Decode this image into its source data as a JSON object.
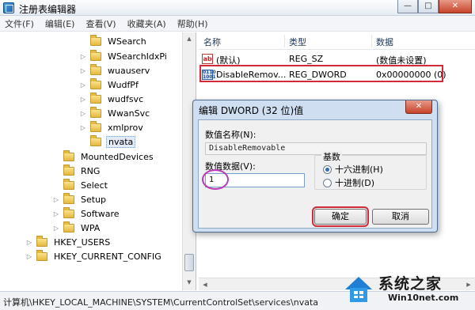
{
  "window": {
    "title": "注册表编辑器",
    "minimize": "—",
    "maximize": "□",
    "close": "✕"
  },
  "menu": [
    "文件(F)",
    "编辑(E)",
    "查看(V)",
    "收藏夹(A)",
    "帮助(H)"
  ],
  "tree": {
    "items": [
      {
        "label": "WSearch",
        "expandable": false
      },
      {
        "label": "WSearchIdxPi",
        "expandable": true
      },
      {
        "label": "wuauserv",
        "expandable": true
      },
      {
        "label": "WudfPf",
        "expandable": true
      },
      {
        "label": "wudfsvc",
        "expandable": true
      },
      {
        "label": "WwanSvc",
        "expandable": true
      },
      {
        "label": "xmlprov",
        "expandable": true
      },
      {
        "label": "nvata",
        "expandable": false,
        "selected": true
      },
      {
        "label": "MountedDevices",
        "expandable": false
      },
      {
        "label": "RNG",
        "expandable": false
      },
      {
        "label": "Select",
        "expandable": false
      },
      {
        "label": "Setup",
        "expandable": true
      },
      {
        "label": "Software",
        "expandable": true
      },
      {
        "label": "WPA",
        "expandable": true
      },
      {
        "label": "HKEY_USERS",
        "expandable": true
      },
      {
        "label": "HKEY_CURRENT_CONFIG",
        "expandable": true
      }
    ]
  },
  "list": {
    "columns": [
      "名称",
      "类型",
      "数据"
    ],
    "rows": [
      {
        "icon": "ab",
        "name": "(默认)",
        "type": "REG_SZ",
        "data": "(数值未设置)"
      },
      {
        "icon": "bin",
        "name": "DisableRemov...",
        "type": "REG_DWORD",
        "data": "0x00000000 (0)"
      }
    ]
  },
  "dialog": {
    "title": "编辑 DWORD (32 位)值",
    "close": "✕",
    "value_name_label": "数值名称(N):",
    "value_name": "DisableRemovable",
    "value_data_label": "数值数据(V):",
    "value_data": "1",
    "base_label": "基数",
    "radio_hex": "十六进制(H)",
    "radio_dec": "十进制(D)",
    "ok": "确定",
    "cancel": "取消"
  },
  "status": "计算机\\HKEY_LOCAL_MACHINE\\SYSTEM\\CurrentControlSet\\services\\nvata",
  "watermark": {
    "title": "系统之家",
    "url": "Win10net.com"
  },
  "colors": {
    "highlight": "#d32a3a",
    "circle": "#b93ab8"
  }
}
